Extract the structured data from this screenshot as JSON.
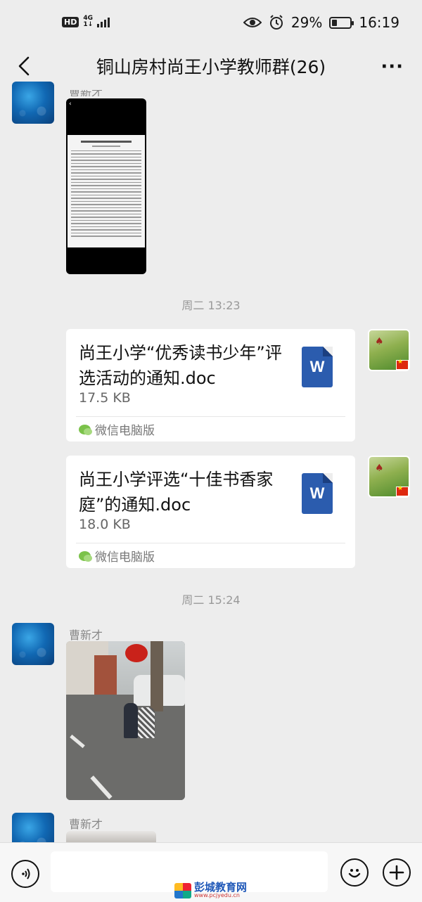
{
  "status_bar": {
    "hd": "HD",
    "network": "4G",
    "network_sub": "1↓",
    "battery_percent": "29%",
    "battery_level": 0.29,
    "time": "16:19"
  },
  "header": {
    "title": "铜山房村尚王小学教师群(26)",
    "back_icon": "chevron-left-icon",
    "more_label": "···"
  },
  "messages": [
    {
      "type": "image",
      "sender": "曹新才",
      "image_desc": "document-screenshot"
    },
    {
      "type": "timestamp",
      "text": "周二 13:23"
    },
    {
      "type": "file",
      "side": "right",
      "file_name": "尚王小学“优秀读书少年”评选活动的通知.doc",
      "file_size": "17.5 KB",
      "source": "微信电脑版",
      "file_icon": "W"
    },
    {
      "type": "file",
      "side": "right",
      "file_name": "尚王小学评选“十佳书香家庭”的通知.doc",
      "file_size": "18.0 KB",
      "source": "微信电脑版",
      "file_icon": "W"
    },
    {
      "type": "timestamp",
      "text": "周二 15:24"
    },
    {
      "type": "image",
      "sender": "曹新才",
      "image_desc": "photo-children-playing"
    },
    {
      "type": "image",
      "sender": "曹新才",
      "image_desc": "photo-partial"
    }
  ],
  "input_bar": {
    "voice_icon": "voice-icon",
    "emoji_icon": "emoji-icon",
    "plus_icon": "plus-icon",
    "input_value": ""
  },
  "watermark": {
    "name": "彭城教育网",
    "url": "www.pcjyedu.cn"
  }
}
